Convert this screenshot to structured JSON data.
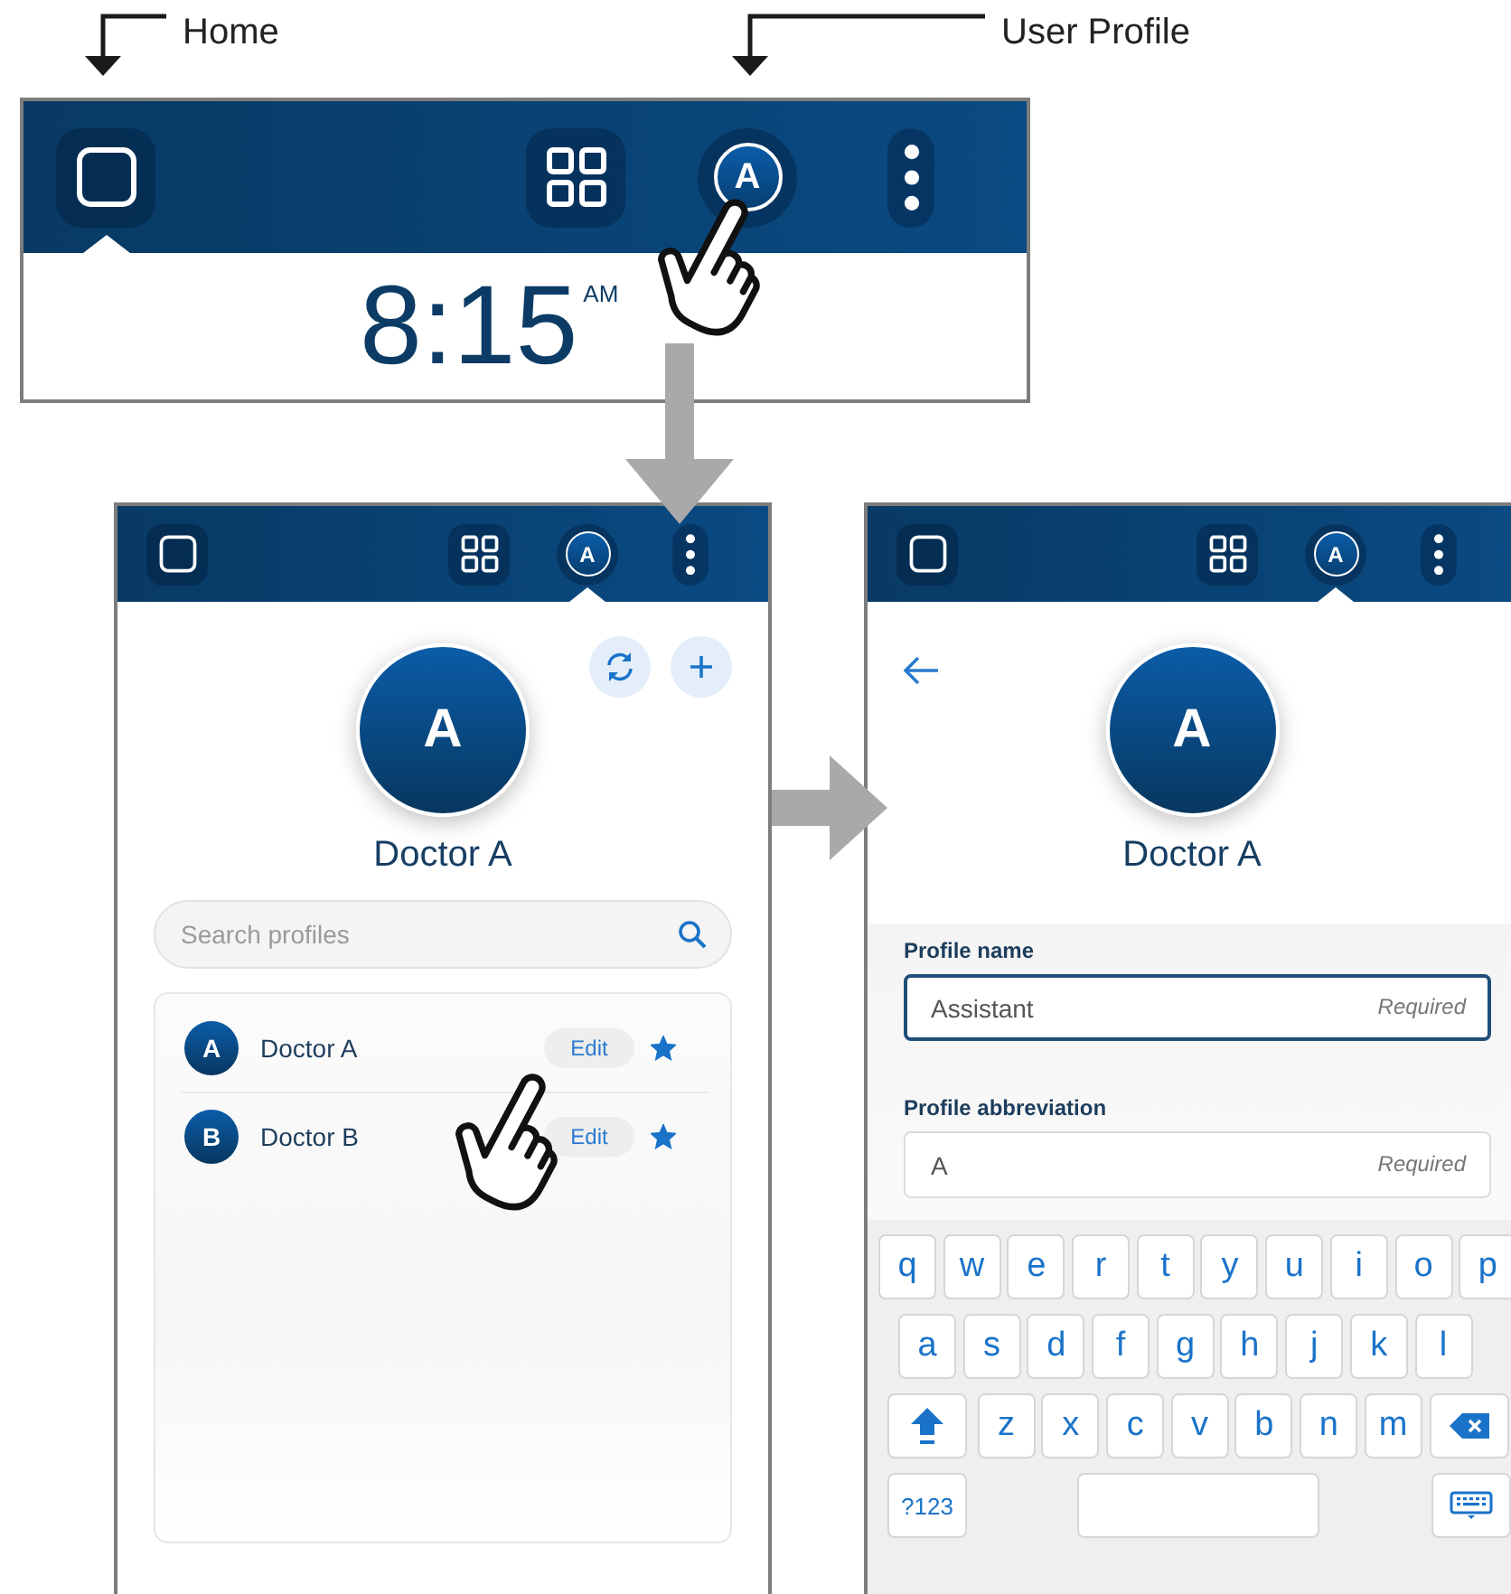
{
  "callouts": [
    {
      "label": "Home"
    },
    {
      "label": "User Profile"
    }
  ],
  "screens": [
    {
      "kind": "home",
      "nav": [
        {
          "kind": "home",
          "selected": true
        },
        {
          "kind": "apps",
          "selected": false
        },
        {
          "kind": "profile",
          "label": "A",
          "selected": false
        },
        {
          "kind": "more",
          "selected": false
        }
      ],
      "clock": "8:15",
      "clock_suffix": "AM"
    },
    {
      "kind": "profiles",
      "nav": [
        {
          "kind": "home",
          "selected": false
        },
        {
          "kind": "apps",
          "selected": false
        },
        {
          "kind": "profile",
          "label": "A",
          "selected": true
        },
        {
          "kind": "more",
          "selected": false
        }
      ],
      "avatar": "A",
      "name": "Doctor A",
      "search": {
        "placeholder": "Search profiles"
      },
      "profiles": [
        {
          "initial": "A",
          "name": "Doctor A",
          "action": "Edit",
          "favorite": true
        },
        {
          "initial": "B",
          "name": "Doctor B",
          "action": "Edit",
          "favorite": true
        }
      ]
    },
    {
      "kind": "edit_profile",
      "nav": [
        {
          "kind": "home",
          "selected": false
        },
        {
          "kind": "apps",
          "selected": false
        },
        {
          "kind": "profile",
          "label": "A",
          "selected": true
        },
        {
          "kind": "more",
          "selected": false
        }
      ],
      "avatar": "A",
      "name": "Doctor A",
      "fields": [
        {
          "label": "Profile name",
          "value": "Assistant",
          "note": "Required",
          "focused": true
        },
        {
          "label": "Profile abbreviation",
          "value": "A",
          "note": "Required",
          "focused": false
        }
      ],
      "keyboard": {
        "rows": [
          [
            {
              "kind": "letter",
              "label": "q"
            },
            {
              "kind": "letter",
              "label": "w"
            },
            {
              "kind": "letter",
              "label": "e"
            },
            {
              "kind": "letter",
              "label": "r"
            },
            {
              "kind": "letter",
              "label": "t"
            },
            {
              "kind": "letter",
              "label": "y"
            },
            {
              "kind": "letter",
              "label": "u"
            },
            {
              "kind": "letter",
              "label": "i"
            },
            {
              "kind": "letter",
              "label": "o"
            },
            {
              "kind": "letter",
              "label": "p"
            }
          ],
          [
            {
              "kind": "letter",
              "label": "a"
            },
            {
              "kind": "letter",
              "label": "s"
            },
            {
              "kind": "letter",
              "label": "d"
            },
            {
              "kind": "letter",
              "label": "f"
            },
            {
              "kind": "letter",
              "label": "g"
            },
            {
              "kind": "letter",
              "label": "h"
            },
            {
              "kind": "letter",
              "label": "j"
            },
            {
              "kind": "letter",
              "label": "k"
            },
            {
              "kind": "letter",
              "label": "l"
            }
          ],
          [
            {
              "kind": "shift"
            },
            {
              "kind": "letter",
              "label": "z"
            },
            {
              "kind": "letter",
              "label": "x"
            },
            {
              "kind": "letter",
              "label": "c"
            },
            {
              "kind": "letter",
              "label": "v"
            },
            {
              "kind": "letter",
              "label": "b"
            },
            {
              "kind": "letter",
              "label": "n"
            },
            {
              "kind": "letter",
              "label": "m"
            },
            {
              "kind": "backspace"
            }
          ],
          [
            {
              "kind": "symbols",
              "label": "?123"
            },
            {
              "kind": "space"
            },
            {
              "kind": "hide"
            }
          ]
        ]
      }
    }
  ]
}
